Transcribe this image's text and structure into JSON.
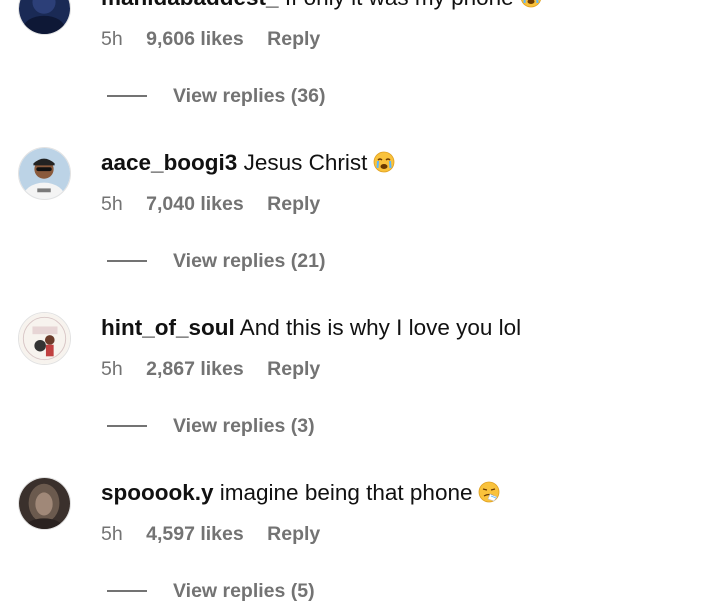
{
  "comments": [
    {
      "username": "manidabaddest_",
      "text": "If only it was my phone",
      "emoji": "loudly-crying-face",
      "time": "5h",
      "likes": "9,606 likes",
      "reply": "Reply",
      "view_replies": "View replies (36)"
    },
    {
      "username": "aace_boogi3",
      "text": "Jesus Christ",
      "emoji": "loudly-crying-face",
      "time": "5h",
      "likes": "7,040 likes",
      "reply": "Reply",
      "view_replies": "View replies (21)"
    },
    {
      "username": "hint_of_soul",
      "text": "And this is why I love you lol",
      "emoji": "",
      "time": "5h",
      "likes": "2,867 likes",
      "reply": "Reply",
      "view_replies": "View replies (3)"
    },
    {
      "username": "spooook.y",
      "text": "imagine being that phone",
      "emoji": "sneezing-face",
      "time": "5h",
      "likes": "4,597 likes",
      "reply": "Reply",
      "view_replies": "View replies (5)"
    }
  ]
}
